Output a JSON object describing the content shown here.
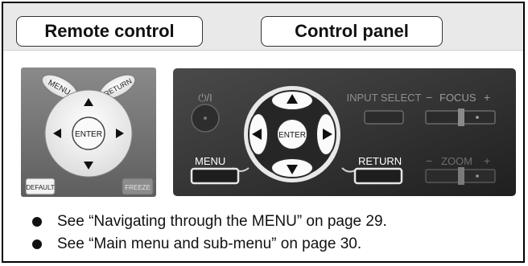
{
  "tabs": {
    "remote_label": "Remote control",
    "panel_label": "Control panel"
  },
  "remote": {
    "menu": "MENU",
    "return": "RETURN",
    "enter": "ENTER",
    "default": "DEFAULT",
    "freeze": "FREEZE"
  },
  "panel": {
    "power": "⏻/I",
    "input_select": "INPUT SELECT",
    "focus": "FOCUS",
    "zoom": "ZOOM",
    "minus": "−",
    "plus": "+",
    "menu": "MENU",
    "return": "RETURN",
    "enter": "ENTER"
  },
  "notes": [
    "See “Navigating through the MENU” on page 29.",
    "See “Main menu and sub-menu” on page 30."
  ]
}
